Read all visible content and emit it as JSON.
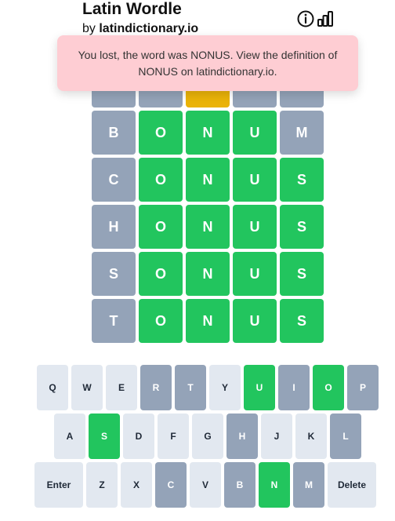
{
  "header": {
    "title": "Latin Wordle",
    "by_prefix": "by",
    "site_link": "latindictionary.io",
    "info_icon": "info-icon",
    "stats_icon": "bar-chart-icon"
  },
  "toast": {
    "message": "You lost, the word was NONUS. View the definition of NONUS on latindictionary.io."
  },
  "colors": {
    "correct": "#22c55e",
    "present": "#eab308",
    "absent": "#94a3b8",
    "unused_key": "#e2e8f0",
    "toast_bg": "#fecdd3"
  },
  "board": {
    "rows": [
      [
        {
          "letter": "",
          "state": "absent"
        },
        {
          "letter": "",
          "state": "absent"
        },
        {
          "letter": "",
          "state": "present"
        },
        {
          "letter": "",
          "state": "absent"
        },
        {
          "letter": "",
          "state": "absent"
        }
      ],
      [
        {
          "letter": "B",
          "state": "absent"
        },
        {
          "letter": "O",
          "state": "correct"
        },
        {
          "letter": "N",
          "state": "correct"
        },
        {
          "letter": "U",
          "state": "correct"
        },
        {
          "letter": "M",
          "state": "absent"
        }
      ],
      [
        {
          "letter": "C",
          "state": "absent"
        },
        {
          "letter": "O",
          "state": "correct"
        },
        {
          "letter": "N",
          "state": "correct"
        },
        {
          "letter": "U",
          "state": "correct"
        },
        {
          "letter": "S",
          "state": "correct"
        }
      ],
      [
        {
          "letter": "H",
          "state": "absent"
        },
        {
          "letter": "O",
          "state": "correct"
        },
        {
          "letter": "N",
          "state": "correct"
        },
        {
          "letter": "U",
          "state": "correct"
        },
        {
          "letter": "S",
          "state": "correct"
        }
      ],
      [
        {
          "letter": "S",
          "state": "absent"
        },
        {
          "letter": "O",
          "state": "correct"
        },
        {
          "letter": "N",
          "state": "correct"
        },
        {
          "letter": "U",
          "state": "correct"
        },
        {
          "letter": "S",
          "state": "correct"
        }
      ],
      [
        {
          "letter": "T",
          "state": "absent"
        },
        {
          "letter": "O",
          "state": "correct"
        },
        {
          "letter": "N",
          "state": "correct"
        },
        {
          "letter": "U",
          "state": "correct"
        },
        {
          "letter": "S",
          "state": "correct"
        }
      ]
    ]
  },
  "keyboard": {
    "rows": [
      [
        {
          "label": "Q",
          "state": "unused"
        },
        {
          "label": "W",
          "state": "unused"
        },
        {
          "label": "E",
          "state": "unused"
        },
        {
          "label": "R",
          "state": "absent"
        },
        {
          "label": "T",
          "state": "absent"
        },
        {
          "label": "Y",
          "state": "unused"
        },
        {
          "label": "U",
          "state": "correct"
        },
        {
          "label": "I",
          "state": "absent"
        },
        {
          "label": "O",
          "state": "correct"
        },
        {
          "label": "P",
          "state": "absent"
        }
      ],
      [
        {
          "label": "A",
          "state": "unused"
        },
        {
          "label": "S",
          "state": "correct"
        },
        {
          "label": "D",
          "state": "unused"
        },
        {
          "label": "F",
          "state": "unused"
        },
        {
          "label": "G",
          "state": "unused"
        },
        {
          "label": "H",
          "state": "absent"
        },
        {
          "label": "J",
          "state": "unused"
        },
        {
          "label": "K",
          "state": "unused"
        },
        {
          "label": "L",
          "state": "absent"
        }
      ],
      [
        {
          "label": "Enter",
          "state": "unused"
        },
        {
          "label": "Z",
          "state": "unused"
        },
        {
          "label": "X",
          "state": "unused"
        },
        {
          "label": "C",
          "state": "absent"
        },
        {
          "label": "V",
          "state": "unused"
        },
        {
          "label": "B",
          "state": "absent"
        },
        {
          "label": "N",
          "state": "correct"
        },
        {
          "label": "M",
          "state": "absent"
        },
        {
          "label": "Delete",
          "state": "unused"
        }
      ]
    ]
  }
}
